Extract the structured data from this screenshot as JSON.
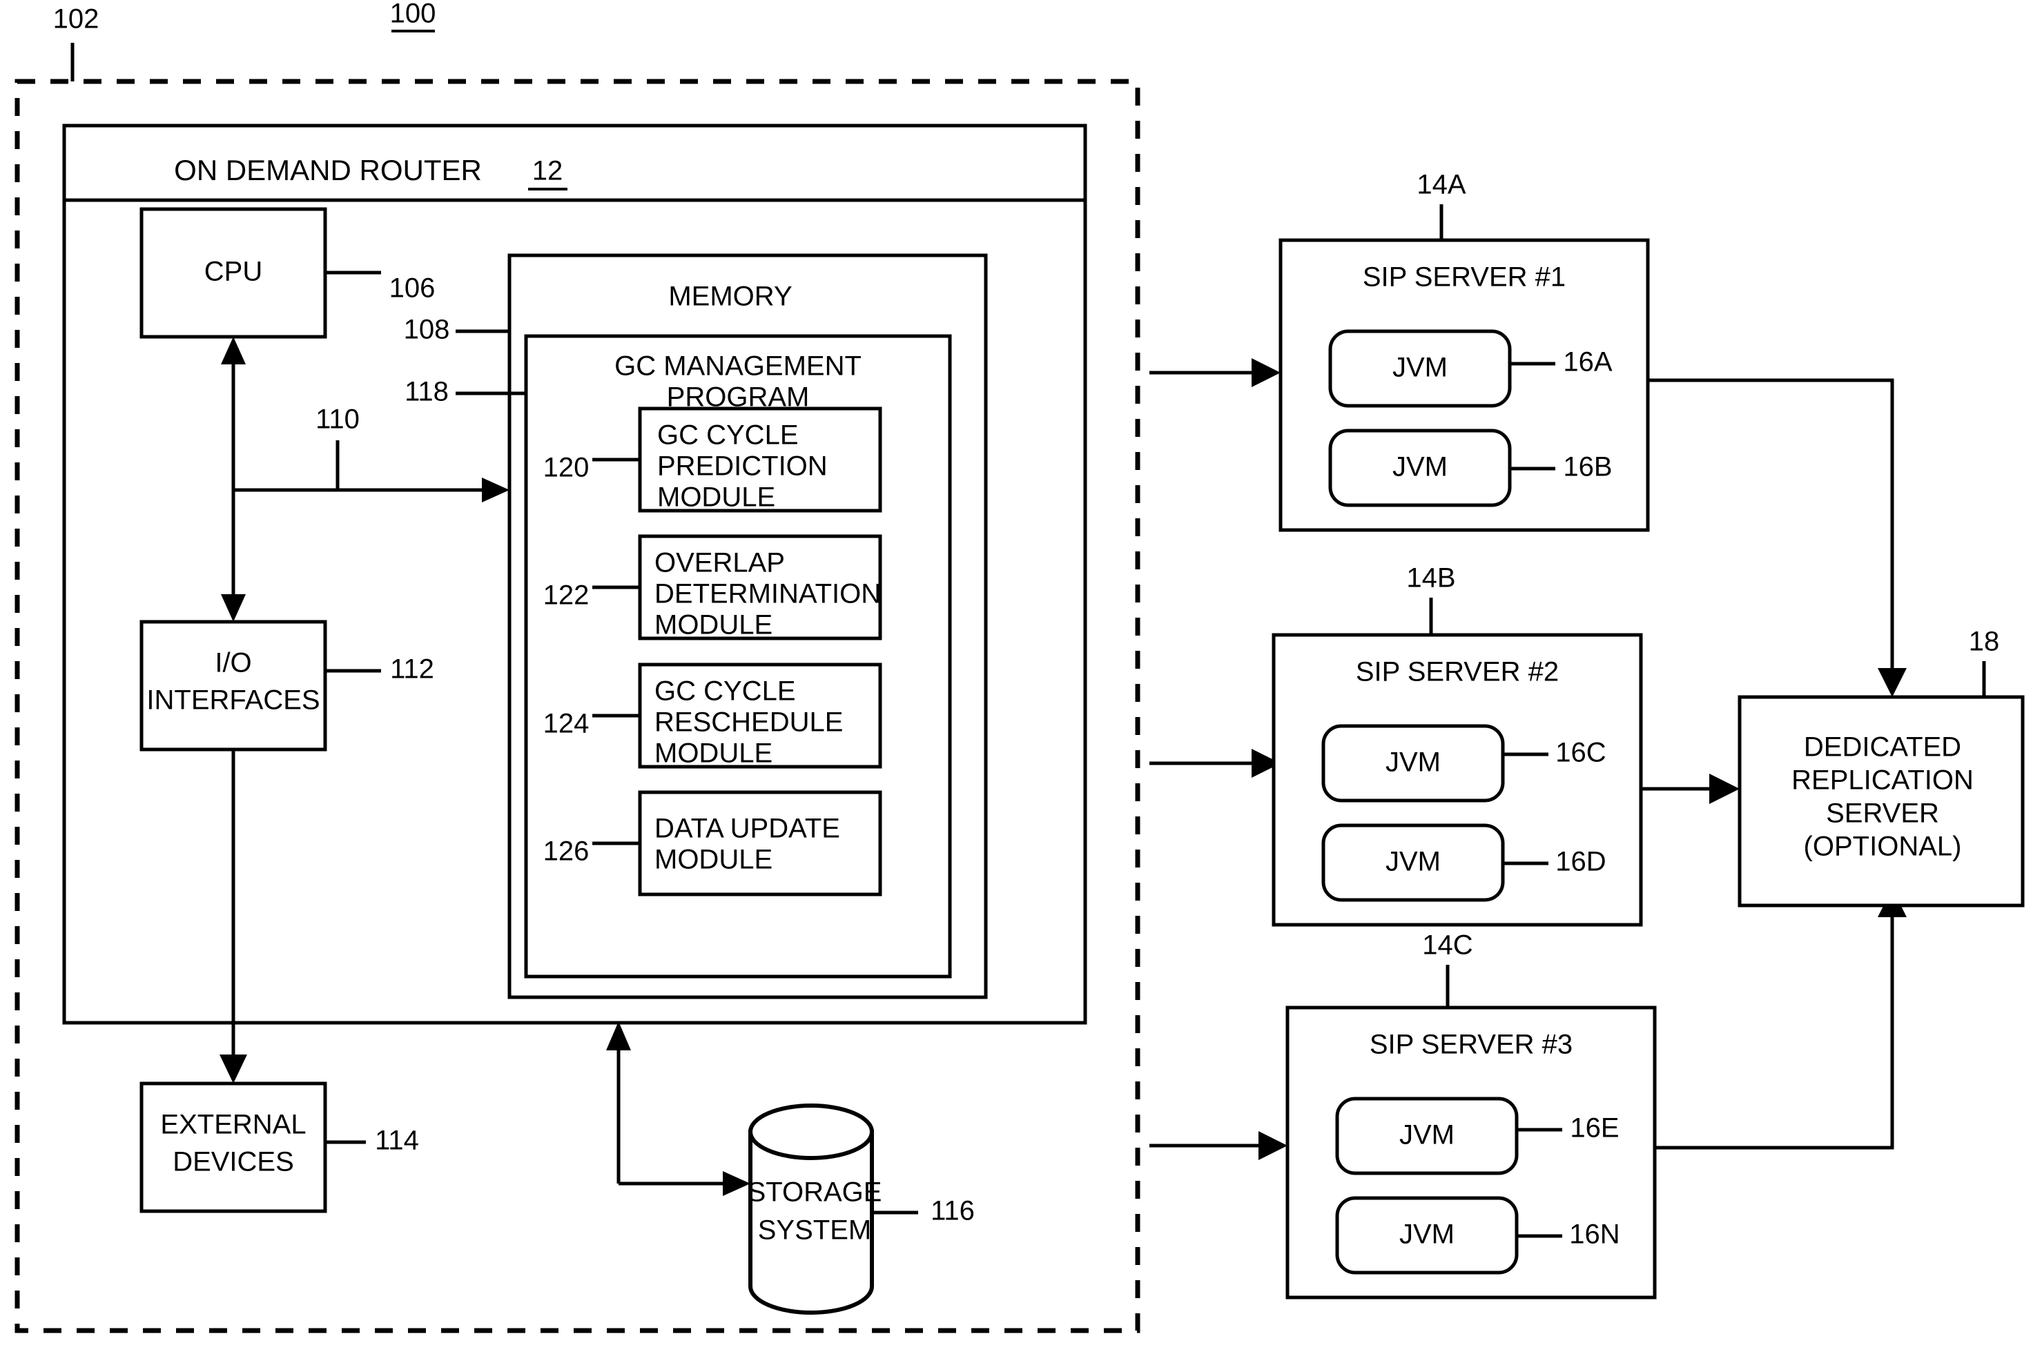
{
  "figure": {
    "figure_ref": "100",
    "environment_ref": "102",
    "router": {
      "title": "ON DEMAND ROUTER",
      "ref": "12"
    },
    "cpu": {
      "label": "CPU",
      "ref": "106"
    },
    "bus": {
      "ref": "110"
    },
    "io": {
      "label_line1": "I/O",
      "label_line2": "INTERFACES",
      "ref": "112"
    },
    "external_devices": {
      "label_line1": "EXTERNAL",
      "label_line2": "DEVICES",
      "ref": "114"
    },
    "storage": {
      "label_line1": "STORAGE",
      "label_line2": "SYSTEM",
      "ref": "116"
    },
    "memory": {
      "label": "MEMORY",
      "ref": "108"
    },
    "gc_program": {
      "label_line1": "GC MANAGEMENT",
      "label_line2": "PROGRAM",
      "ref": "118"
    },
    "modules": [
      {
        "ref": "120",
        "lines": [
          "GC CYCLE",
          "PREDICTION",
          "MODULE"
        ]
      },
      {
        "ref": "122",
        "lines": [
          "OVERLAP",
          "DETERMINATION",
          "MODULE"
        ]
      },
      {
        "ref": "124",
        "lines": [
          "GC CYCLE",
          "RESCHEDULE",
          "MODULE"
        ]
      },
      {
        "ref": "126",
        "lines": [
          "DATA UPDATE",
          "MODULE"
        ]
      }
    ],
    "sip_servers": [
      {
        "title": "SIP SERVER #1",
        "ref": "14A",
        "jvms": [
          {
            "label": "JVM",
            "ref": "16A"
          },
          {
            "label": "JVM",
            "ref": "16B"
          }
        ]
      },
      {
        "title": "SIP SERVER #2",
        "ref": "14B",
        "jvms": [
          {
            "label": "JVM",
            "ref": "16C"
          },
          {
            "label": "JVM",
            "ref": "16D"
          }
        ]
      },
      {
        "title": "SIP SERVER #3",
        "ref": "14C",
        "jvms": [
          {
            "label": "JVM",
            "ref": "16E"
          },
          {
            "label": "JVM",
            "ref": "16N"
          }
        ]
      }
    ],
    "replication_server": {
      "ref": "18",
      "lines": [
        "DEDICATED",
        "REPLICATION",
        "SERVER",
        "(OPTIONAL)"
      ]
    }
  },
  "colors": {
    "ink": "#000000",
    "paper": "#ffffff"
  }
}
